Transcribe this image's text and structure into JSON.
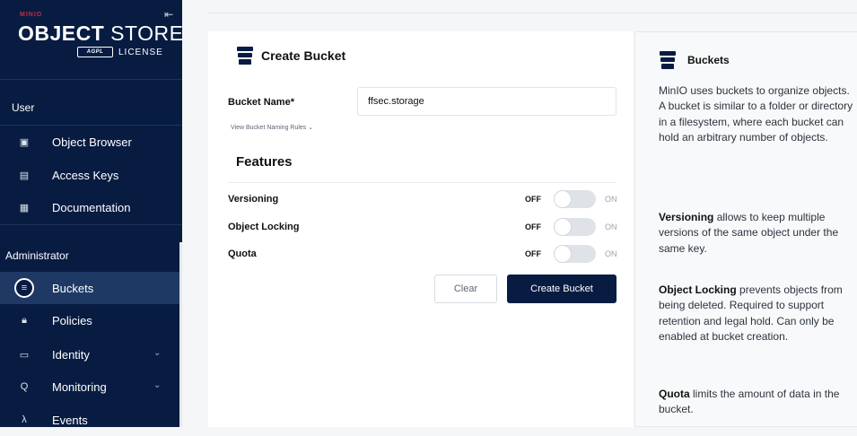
{
  "brand": {
    "top": "MINIO",
    "store_bold": "OBJECT",
    "store_light": " STORE",
    "license_badge": "AGPL",
    "license": "LICENSE",
    "collapse_icon": "collapse-left-icon"
  },
  "sidebar": {
    "user_section": "User",
    "admin_section": "Administrator",
    "user_items": [
      {
        "label": "Object Browser",
        "icon": "object-browser-icon"
      },
      {
        "label": "Access Keys",
        "icon": "access-keys-icon"
      },
      {
        "label": "Documentation",
        "icon": "documentation-icon"
      }
    ],
    "admin_items": [
      {
        "label": "Buckets",
        "icon": "buckets-icon",
        "active": true
      },
      {
        "label": "Policies",
        "icon": "policies-icon"
      },
      {
        "label": "Identity",
        "icon": "identity-icon",
        "expandable": true
      },
      {
        "label": "Monitoring",
        "icon": "monitoring-icon",
        "expandable": true
      },
      {
        "label": "Events",
        "icon": "events-icon"
      }
    ]
  },
  "form": {
    "title": "Create Bucket",
    "bucket_name_label": "Bucket Name*",
    "bucket_name_value": "ffsec.storage",
    "naming_rules": "View Bucket Naming Rules ⌄",
    "features_heading": "Features",
    "features": [
      {
        "label": "Versioning",
        "off": "OFF",
        "on": "ON",
        "enabled": false
      },
      {
        "label": "Object Locking",
        "off": "OFF",
        "on": "ON",
        "enabled": false
      },
      {
        "label": "Quota",
        "off": "OFF",
        "on": "ON",
        "enabled": false
      }
    ],
    "clear_label": "Clear",
    "create_label": "Create Bucket"
  },
  "help": {
    "title": "Buckets",
    "intro": "MinIO uses buckets to organize objects. A bucket is similar to a folder or directory in a filesystem, where each bucket can hold an arbitrary number of objects.",
    "versioning_term": "Versioning",
    "versioning_text": " allows to keep multiple versions of the same object under the same key.",
    "locking_term": "Object Locking",
    "locking_text": " prevents objects from being deleted. Required to support retention and legal hold. Can only be enabled at bucket creation.",
    "quota_term": "Quota",
    "quota_text": " limits the amount of data in the bucket."
  },
  "colors": {
    "sidebar_bg": "#081c42",
    "active_bg": "#1e3a64",
    "brand_red": "#c72c48",
    "primary_button": "#081c42"
  }
}
